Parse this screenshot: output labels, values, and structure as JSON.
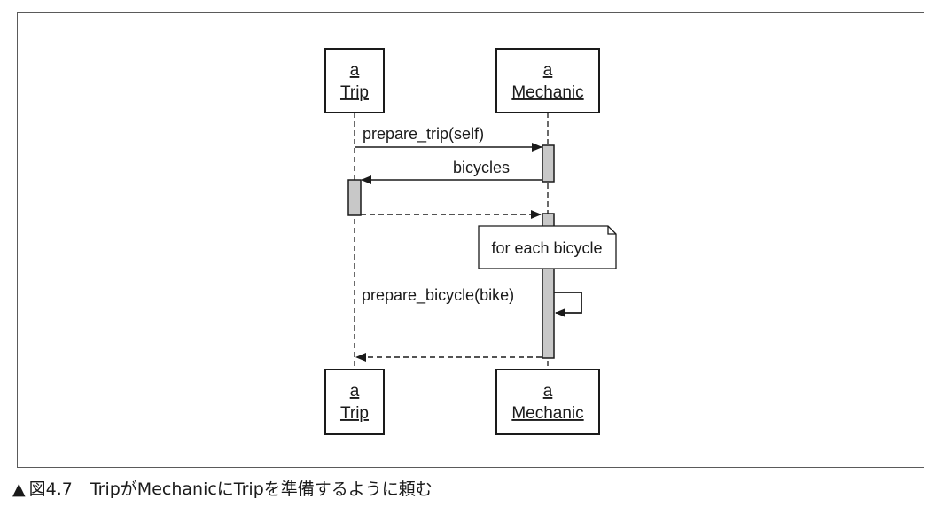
{
  "objects": {
    "trip": {
      "line1": "a",
      "line2": "Trip"
    },
    "mechanic": {
      "line1": "a",
      "line2": "Mechanic"
    }
  },
  "messages": {
    "prepare_trip": "prepare_trip(self)",
    "bicycles": "bicycles",
    "prepare_bicycle": "prepare_bicycle(bike)"
  },
  "note": "for each bicycle",
  "caption": {
    "marker": "▲",
    "label": "図4.7",
    "text": "TripがMechanicにTripを準備するように頼む"
  },
  "colors": {
    "activation_fill": "#c8c8c8",
    "stroke": "#1a1a1a",
    "frame_border": "#5a5a5a"
  }
}
